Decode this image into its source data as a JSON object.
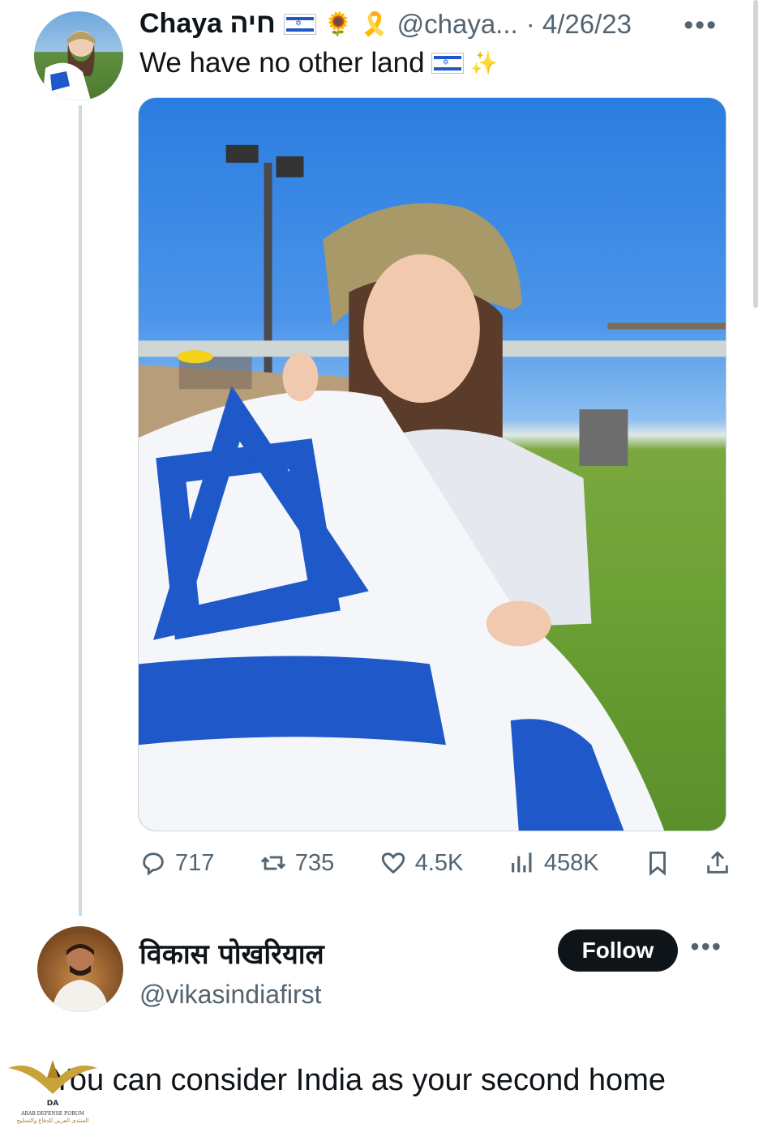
{
  "tweet": {
    "display_name": "Chaya חיה",
    "emojis": [
      "🌻",
      "🎗️"
    ],
    "handle": "@chaya...",
    "date": "· 4/26/23",
    "more": "•••",
    "text": "We have no other land",
    "text_emoji": "✨"
  },
  "actions": {
    "replies": "717",
    "retweets": "735",
    "likes": "4.5K",
    "views": "458K"
  },
  "reply_user": {
    "name": "विकास पोखरियाल",
    "handle": "@vikasindiafirst",
    "follow_label": "Follow",
    "more": "•••"
  },
  "reply": {
    "text": "You can consider India as your second home"
  },
  "watermark": {
    "name": "ARAB DEFENSE FORUM",
    "arabic": "المنتدى العربي للدفاع والتسليح"
  }
}
